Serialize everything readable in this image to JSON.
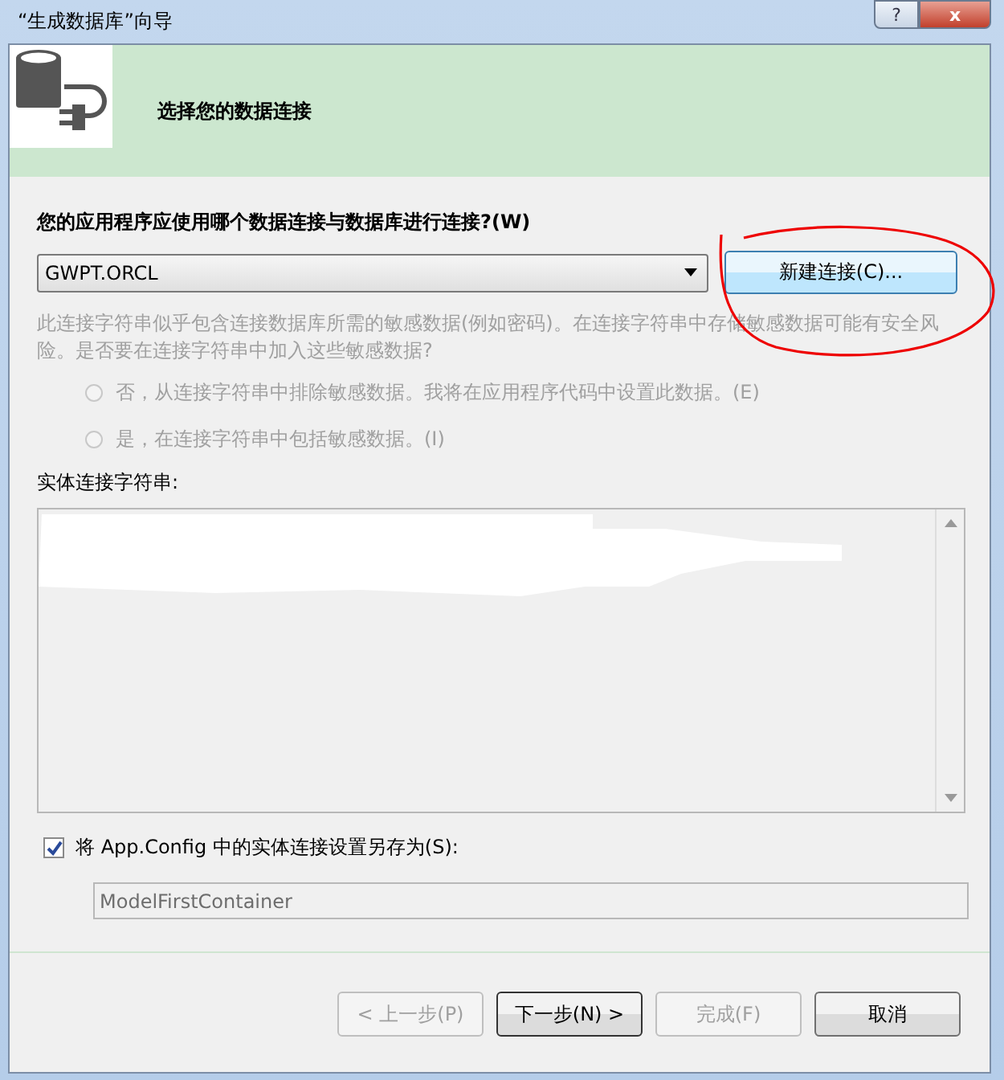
{
  "window": {
    "title": "“生成数据库”向导",
    "buttons": [
      {
        "kind": "help",
        "label": "?"
      },
      {
        "kind": "close",
        "label": "x"
      }
    ]
  },
  "header": {
    "title": "选择您的数据连接"
  },
  "connection": {
    "label": "您的应用程序应使用哪个数据连接与数据库进行连接?(W)",
    "value": "GWPT.ORCL",
    "new_button": "新建连接(C)...",
    "annotated": true
  },
  "sensitive": {
    "text": "此连接字符串似乎包含连接数据库所需的敏感数据(例如密码)。在连接字符串中存储敏感数据可能有安全风险。是否要在连接字符串中加入这些敏感数据?",
    "disabled": true,
    "options": [
      {
        "label": "否，从连接字符串中排除敏感数据。我将在应用程序代码中设置此数据。(E)",
        "selected": false,
        "disabled": true
      },
      {
        "label": "是，在连接字符串中包括敏感数据。(I)",
        "selected": false,
        "disabled": true
      }
    ]
  },
  "entity_string": {
    "label": "实体连接字符串:",
    "redacted": true
  },
  "save": {
    "label": "将 App.Config 中的实体连接设置另存为(S):",
    "checked": true,
    "value": "ModelFirstContainer",
    "disabled": true
  },
  "buttons": [
    {
      "label": "< 上一步(P)",
      "disabled": true,
      "default": false
    },
    {
      "label": "下一步(N) >",
      "disabled": false,
      "default": true
    },
    {
      "label": "完成(F)",
      "disabled": true,
      "default": false
    },
    {
      "label": "取消",
      "disabled": false,
      "default": false
    }
  ]
}
